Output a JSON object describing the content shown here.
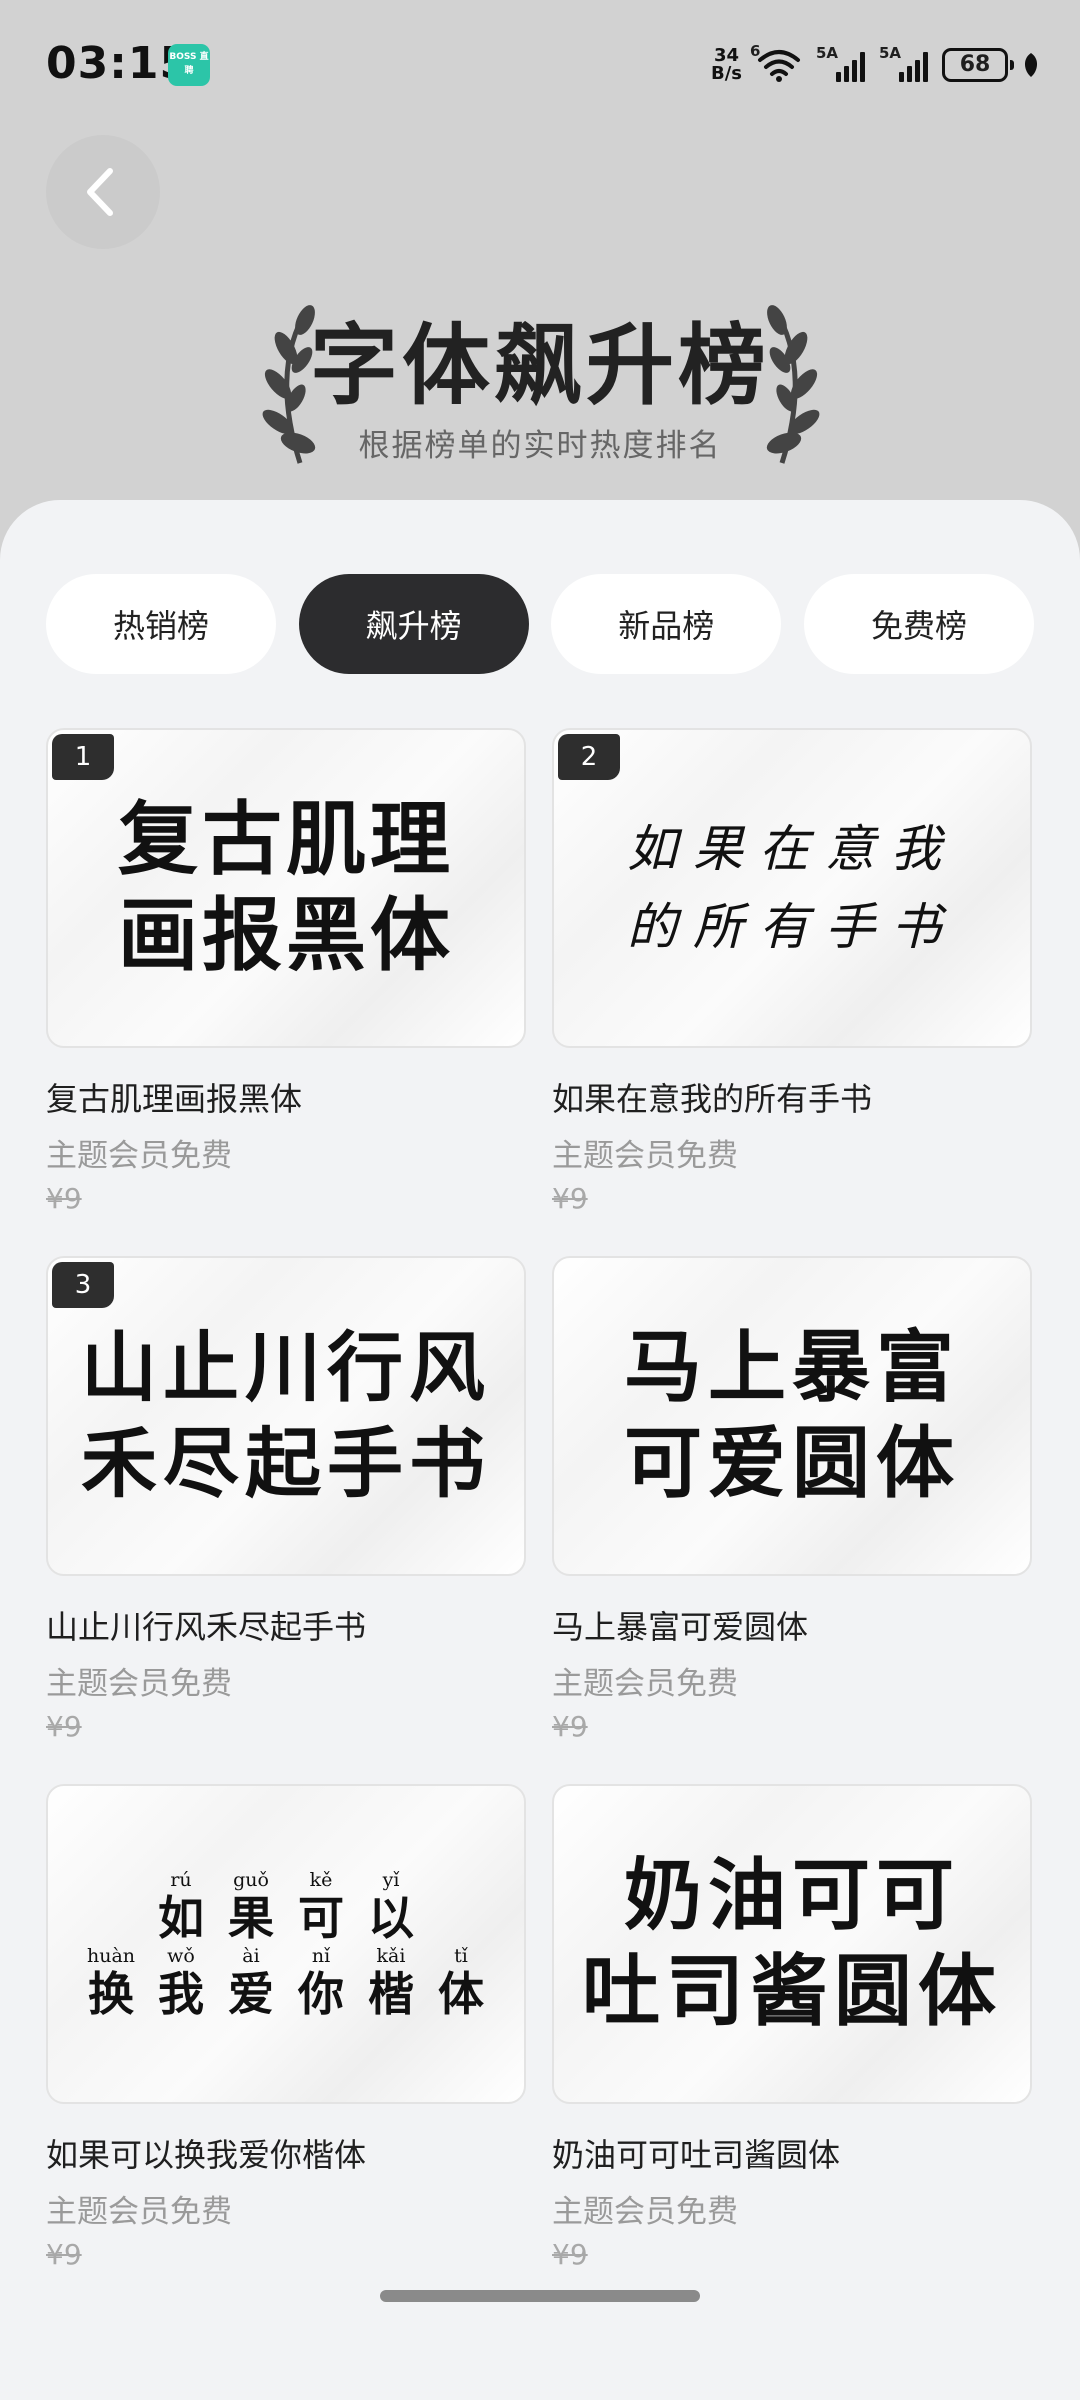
{
  "status_bar": {
    "time": "03:15",
    "app_icon_text": "BOSS 直聘",
    "net_speed_value": "34",
    "net_speed_unit": "B/s",
    "wifi_label": "6",
    "sim1_label": "5A",
    "sim2_label": "5A",
    "battery": "68"
  },
  "header": {
    "title": "字体飙升榜",
    "subtitle": "根据榜单的实时热度排名"
  },
  "tabs": [
    {
      "label": "热销榜",
      "active": false
    },
    {
      "label": "飙升榜",
      "active": true
    },
    {
      "label": "新品榜",
      "active": false
    },
    {
      "label": "免费榜",
      "active": false
    }
  ],
  "fonts": [
    {
      "rank": "1",
      "preview": [
        "复古肌理",
        "画报黑体"
      ],
      "name": "复古肌理画报黑体",
      "tag": "主题会员免费",
      "price": "¥9"
    },
    {
      "rank": "2",
      "preview": [
        "如果在意我",
        "的所有手书"
      ],
      "name": "如果在意我的所有手书",
      "tag": "主题会员免费",
      "price": "¥9"
    },
    {
      "rank": "3",
      "preview": [
        "山止川行风",
        "禾尽起手书"
      ],
      "name": "山止川行风禾尽起手书",
      "tag": "主题会员免费",
      "price": "¥9"
    },
    {
      "rank": "",
      "preview": [
        "马上暴富",
        "可爱圆体"
      ],
      "name": "马上暴富可爱圆体",
      "tag": "主题会员免费",
      "price": "¥9"
    },
    {
      "rank": "",
      "preview_pinyin": {
        "row1": [
          {
            "py": "rú",
            "hz": "如"
          },
          {
            "py": "guǒ",
            "hz": "果"
          },
          {
            "py": "kě",
            "hz": "可"
          },
          {
            "py": "yǐ",
            "hz": "以"
          }
        ],
        "row2": [
          {
            "py": "huàn",
            "hz": "换"
          },
          {
            "py": "wǒ",
            "hz": "我"
          },
          {
            "py": "ài",
            "hz": "爱"
          },
          {
            "py": "nǐ",
            "hz": "你"
          },
          {
            "py": "kǎi",
            "hz": "楷"
          },
          {
            "py": "tǐ",
            "hz": "体"
          }
        ]
      },
      "name": "如果可以换我爱你楷体",
      "tag": "主题会员免费",
      "price": "¥9"
    },
    {
      "rank": "",
      "preview": [
        "奶油可可",
        "吐司酱圆体"
      ],
      "name": "奶油可可吐司酱圆体",
      "tag": "主题会员免费",
      "price": "¥9"
    }
  ]
}
